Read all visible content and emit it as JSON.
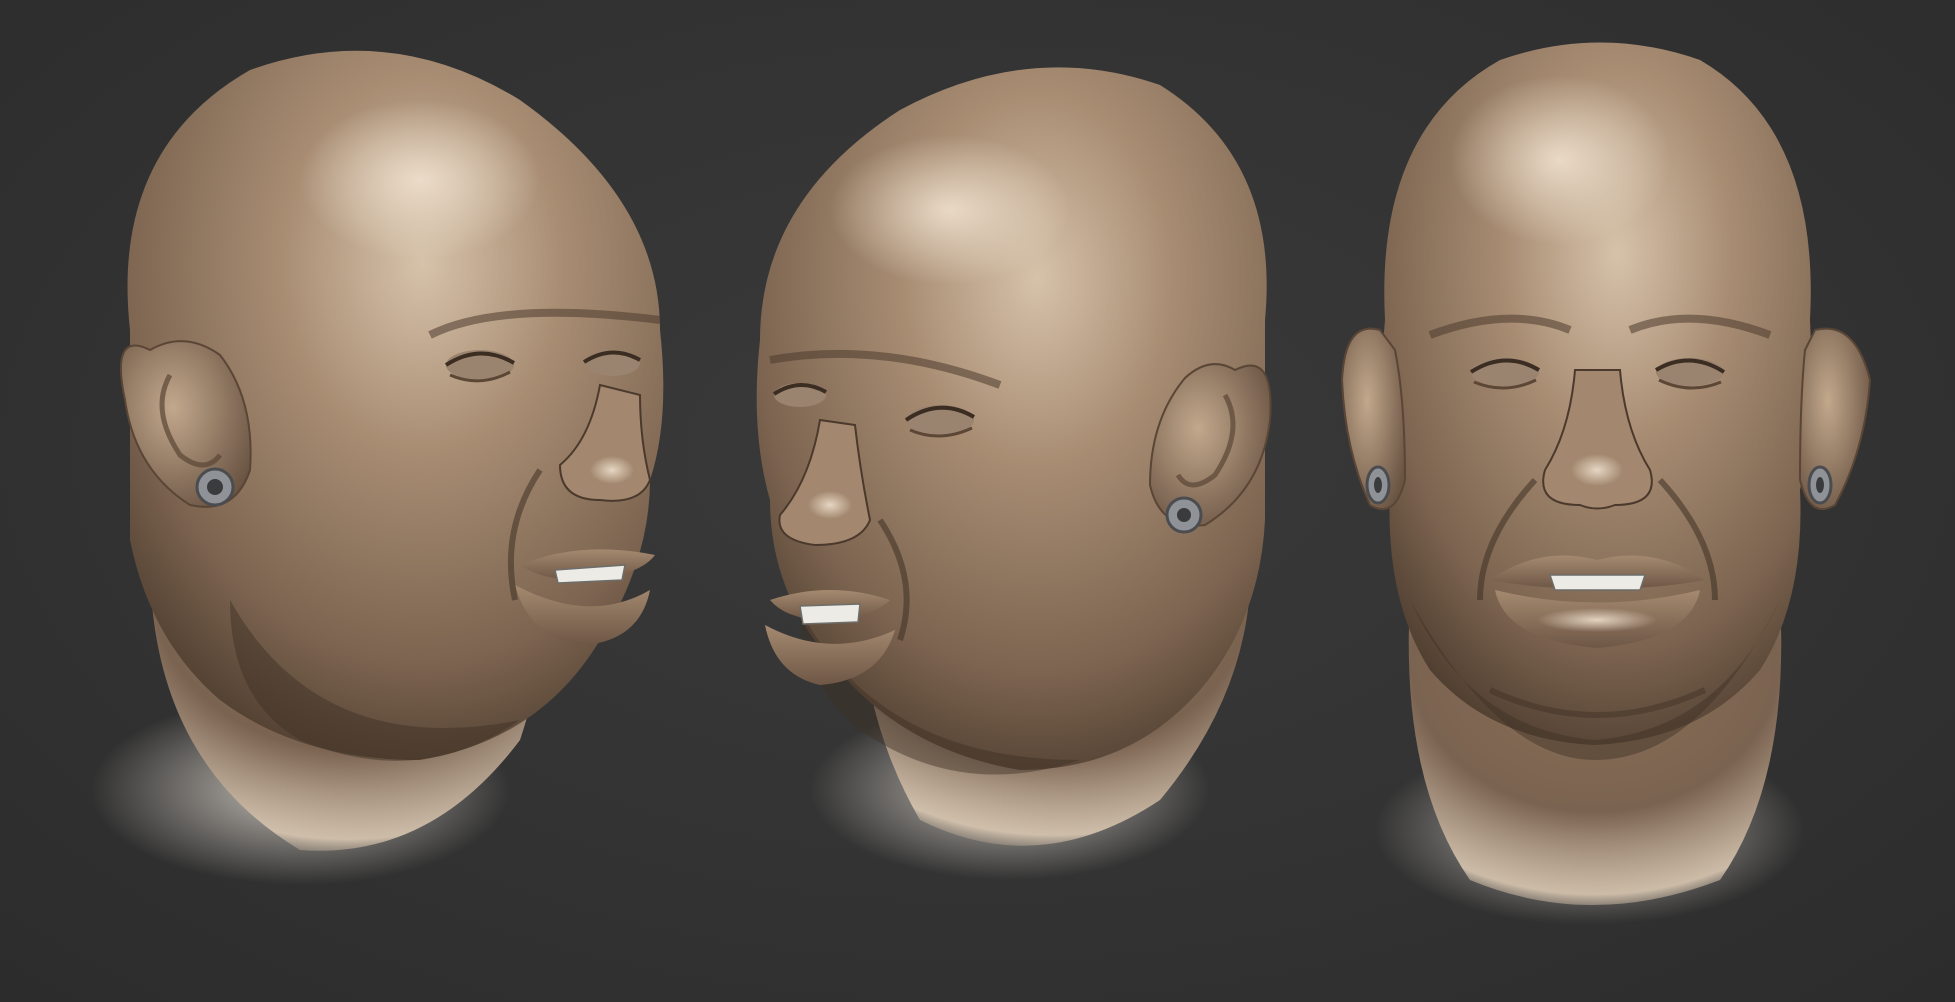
{
  "scene": {
    "background_color": "#333333",
    "clay_color": "#9b8169",
    "clay_highlight": "#d9c5ad",
    "clay_shadow": "#3d2f23",
    "earring_color": "#8f9296",
    "teeth_color": "#ecebe6"
  },
  "renders": [
    {
      "view": "three-quarter-right"
    },
    {
      "view": "three-quarter-left"
    },
    {
      "view": "front"
    }
  ]
}
